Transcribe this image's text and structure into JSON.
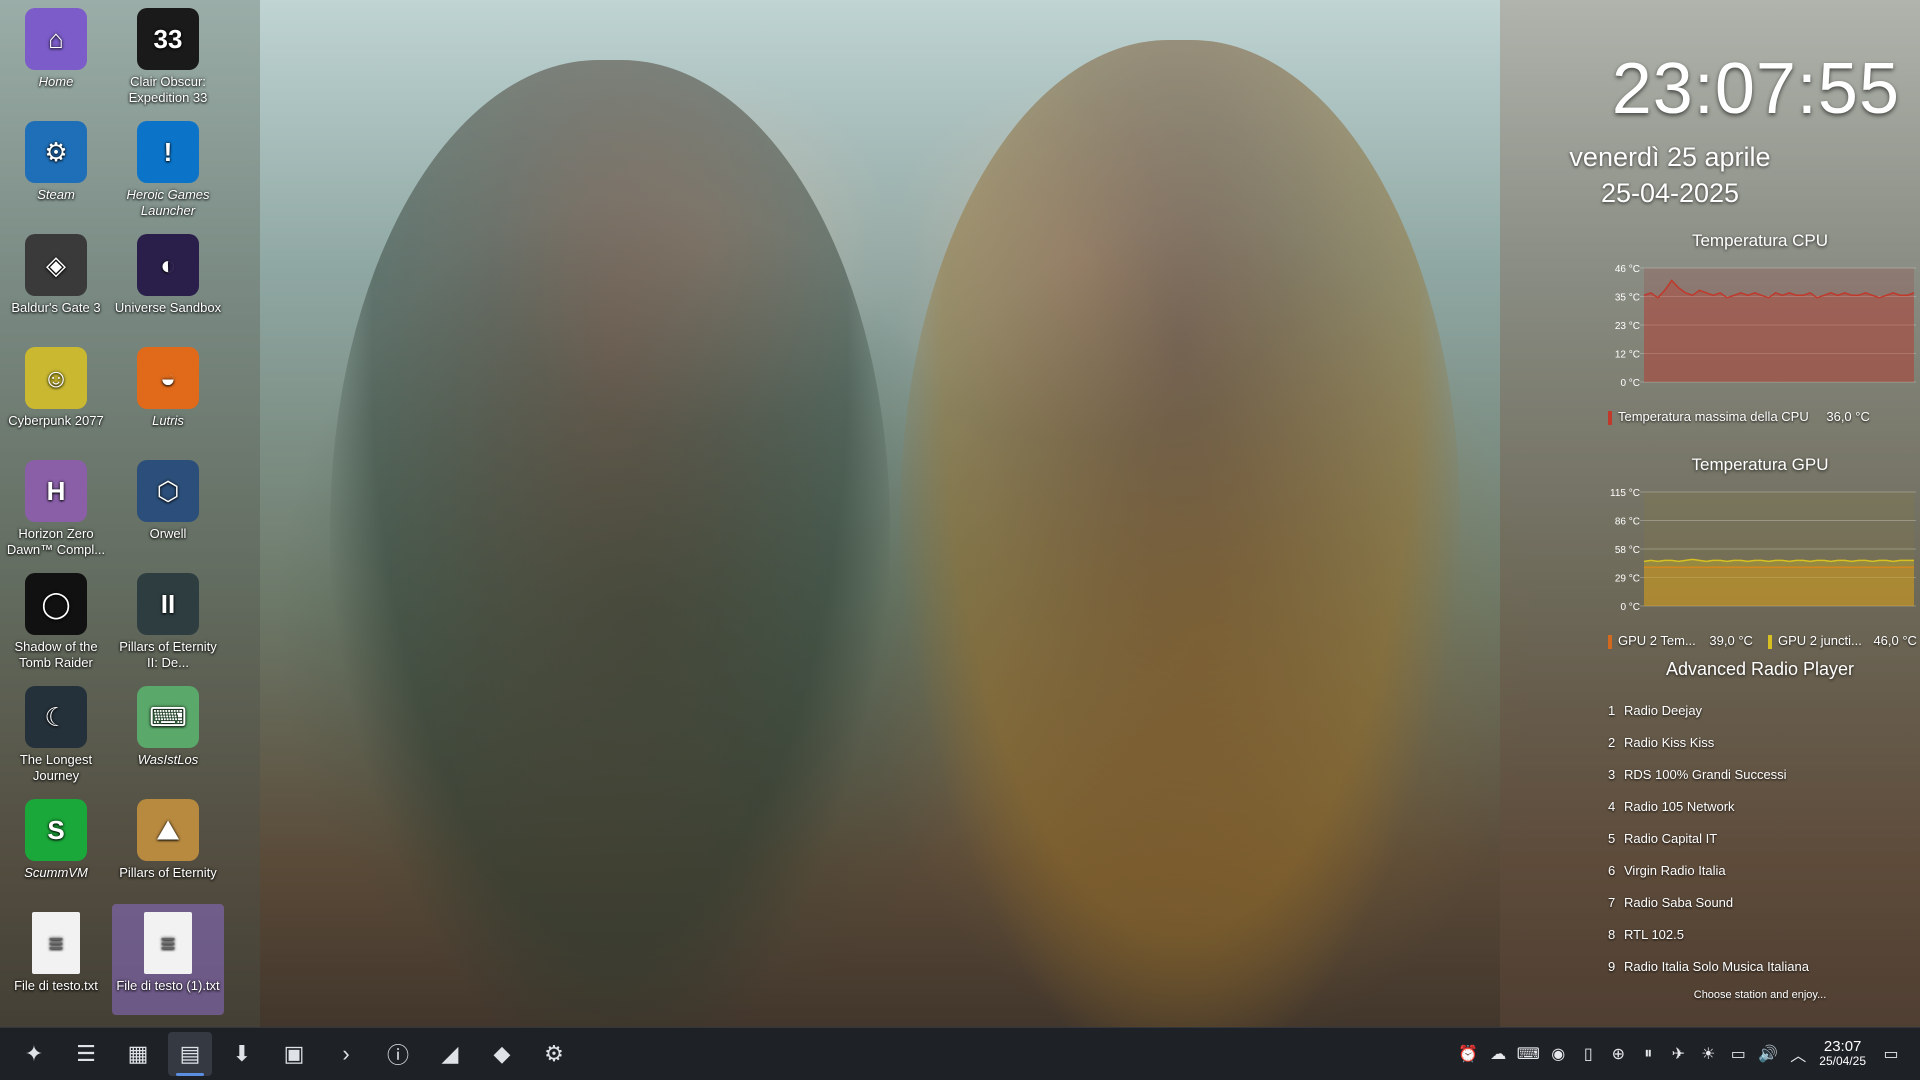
{
  "desktop_icons": [
    {
      "label": "Home",
      "icon": "home-folder-icon",
      "italic": true,
      "color": "#7b5cc8",
      "glyph": "⌂"
    },
    {
      "label": "Clair Obscur: Expedition 33",
      "icon": "clair-obscur-icon",
      "italic": false,
      "color": "#1a1a1a",
      "glyph": "33"
    },
    {
      "label": "Steam",
      "icon": "steam-icon",
      "italic": true,
      "color": "#1f6fb8",
      "glyph": "⚙"
    },
    {
      "label": "Heroic Games Launcher",
      "icon": "heroic-launcher-icon",
      "italic": true,
      "color": "#0b74c9",
      "glyph": "!"
    },
    {
      "label": "Baldur's Gate 3",
      "icon": "baldurs-gate-icon",
      "italic": false,
      "color": "#3a3a3a",
      "glyph": "◈"
    },
    {
      "label": "Universe Sandbox",
      "icon": "universe-sandbox-icon",
      "italic": false,
      "color": "#2a1f4a",
      "glyph": "◐"
    },
    {
      "label": "Cyberpunk 2077",
      "icon": "cyberpunk-icon",
      "italic": false,
      "color": "#c9b830",
      "glyph": "☺"
    },
    {
      "label": "Lutris",
      "icon": "lutris-icon",
      "italic": true,
      "color": "#e06a1a",
      "glyph": "◒"
    },
    {
      "label": "Horizon Zero Dawn™ Compl...",
      "icon": "horizon-zero-dawn-icon",
      "italic": false,
      "color": "#8a5fa8",
      "glyph": "H"
    },
    {
      "label": "Orwell",
      "icon": "orwell-icon",
      "italic": false,
      "color": "#2b4f7a",
      "glyph": "⬡"
    },
    {
      "label": "Shadow of the Tomb Raider",
      "icon": "tomb-raider-icon",
      "italic": false,
      "color": "#111111",
      "glyph": "◯"
    },
    {
      "label": "Pillars of Eternity II: De...",
      "icon": "pillars-eternity-2-icon",
      "italic": false,
      "color": "#2d3d40",
      "glyph": "II"
    },
    {
      "label": "The Longest Journey",
      "icon": "longest-journey-icon",
      "italic": false,
      "color": "#24303a",
      "glyph": "☾"
    },
    {
      "label": "WasIstLos",
      "icon": "wasistlos-icon",
      "italic": true,
      "color": "#5aa86a",
      "glyph": "⌨"
    },
    {
      "label": "ScummVM",
      "icon": "scummvm-icon",
      "italic": true,
      "color": "#1aa83a",
      "glyph": "S"
    },
    {
      "label": "Pillars of Eternity",
      "icon": "pillars-eternity-icon",
      "italic": false,
      "color": "#b88a40",
      "glyph": "⛰"
    },
    {
      "label": "File di testo.txt",
      "icon": "text-file-icon",
      "italic": false,
      "color": "#f2f2f2",
      "glyph": "≡"
    },
    {
      "label": "File di testo (1).txt",
      "icon": "text-file-icon",
      "italic": false,
      "color": "#f2f2f2",
      "glyph": "≡",
      "selected": true
    }
  ],
  "clock": {
    "time": "23:07:55",
    "weekday_date": "venerdì 25 aprile",
    "numeric_date": "25-04-2025"
  },
  "cpu_widget": {
    "title": "Temperatura CPU",
    "y_ticks": [
      "46 °C",
      "35 °C",
      "23 °C",
      "12 °C",
      "0 °C"
    ],
    "legend": [
      {
        "label": "Temperatura massima della CPU",
        "value": "36,0 °C",
        "color": "#c0392b"
      }
    ]
  },
  "gpu_widget": {
    "title": "Temperatura GPU",
    "y_ticks": [
      "115 °C",
      "86 °C",
      "58 °C",
      "29 °C",
      "0 °C"
    ],
    "legend": [
      {
        "label": "GPU 2 Tem...",
        "value": "39,0 °C",
        "color": "#d2691e"
      },
      {
        "label": "GPU 2 juncti...",
        "value": "46,0 °C",
        "color": "#d8c020"
      }
    ]
  },
  "chart_data": [
    {
      "type": "line",
      "title": "Temperatura CPU",
      "ylim": [
        0,
        46
      ],
      "series": [
        {
          "name": "Temperatura massima della CPU",
          "values": [
            35,
            36,
            34,
            37,
            41,
            38,
            36,
            35,
            37,
            36,
            35,
            36,
            34,
            35,
            36,
            35,
            36,
            35,
            34,
            36,
            35,
            36,
            35,
            35,
            36,
            34,
            35,
            36,
            35,
            36,
            35,
            35,
            36,
            35,
            34,
            35,
            36,
            35,
            35,
            36
          ]
        }
      ]
    },
    {
      "type": "line",
      "title": "Temperatura GPU",
      "ylim": [
        0,
        115
      ],
      "series": [
        {
          "name": "GPU 2 Tem...",
          "values": [
            39,
            39,
            39,
            39,
            39,
            39,
            39,
            39,
            39,
            39,
            39,
            39,
            39,
            39,
            39,
            39,
            39,
            39,
            39,
            39,
            39,
            39,
            39,
            39,
            39,
            39,
            39,
            39,
            39,
            39,
            39,
            39,
            39,
            39,
            39,
            39,
            39,
            39,
            39,
            39
          ]
        },
        {
          "name": "GPU 2 juncti...",
          "values": [
            45,
            46,
            45,
            46,
            46,
            45,
            46,
            47,
            46,
            45,
            46,
            46,
            45,
            46,
            46,
            45,
            46,
            46,
            45,
            46,
            46,
            45,
            46,
            46,
            45,
            46,
            46,
            45,
            46,
            46,
            45,
            46,
            46,
            45,
            46,
            46,
            45,
            46,
            46,
            46
          ]
        }
      ]
    }
  ],
  "radio": {
    "title": "Advanced Radio Player",
    "stations": [
      {
        "num": "1",
        "name": "Radio Deejay"
      },
      {
        "num": "2",
        "name": "Radio Kiss Kiss"
      },
      {
        "num": "3",
        "name": "RDS 100% Grandi Successi"
      },
      {
        "num": "4",
        "name": "Radio 105 Network"
      },
      {
        "num": "5",
        "name": "Radio Capital IT"
      },
      {
        "num": "6",
        "name": "Virgin Radio Italia"
      },
      {
        "num": "7",
        "name": "Radio Saba Sound"
      },
      {
        "num": "8",
        "name": "RTL 102.5"
      },
      {
        "num": "9",
        "name": "Radio Italia Solo Musica Italiana"
      }
    ],
    "footer": "Choose station and enjoy..."
  },
  "taskbar": {
    "apps": [
      {
        "name": "app-launcher-icon",
        "glyph": "✦"
      },
      {
        "name": "task-manager-icon",
        "glyph": "☰"
      },
      {
        "name": "app-grid-icon",
        "glyph": "▦"
      },
      {
        "name": "file-manager-icon",
        "glyph": "▤",
        "active": true
      },
      {
        "name": "download-icon",
        "glyph": "⬇"
      },
      {
        "name": "archive-icon",
        "glyph": "▣"
      },
      {
        "name": "terminal-icon",
        "glyph": "›"
      },
      {
        "name": "info-center-icon",
        "glyph": "ⓘ"
      },
      {
        "name": "system-monitor-icon",
        "glyph": "◢"
      },
      {
        "name": "brave-browser-icon",
        "glyph": "◆"
      },
      {
        "name": "steam-taskbar-icon",
        "glyph": "⚙"
      }
    ],
    "tray": [
      {
        "name": "notifications-icon",
        "glyph": "⏰"
      },
      {
        "name": "cloud-icon",
        "glyph": "☁"
      },
      {
        "name": "keyboard-icon",
        "glyph": "⌨"
      },
      {
        "name": "steam-tray-icon",
        "glyph": "◉"
      },
      {
        "name": "clipboard-icon",
        "glyph": "▯"
      },
      {
        "name": "discover-updates-icon",
        "glyph": "⊕"
      },
      {
        "name": "media-pause-icon",
        "glyph": "⏸"
      },
      {
        "name": "kde-connect-icon",
        "glyph": "✈"
      },
      {
        "name": "brightness-icon",
        "glyph": "☀"
      },
      {
        "name": "display-icon",
        "glyph": "▭"
      },
      {
        "name": "volume-icon",
        "glyph": "🔊"
      },
      {
        "name": "tray-expand-icon",
        "glyph": "︿"
      }
    ],
    "time": "23:07",
    "date": "25/04/25",
    "show_desktop_glyph": "▭"
  }
}
